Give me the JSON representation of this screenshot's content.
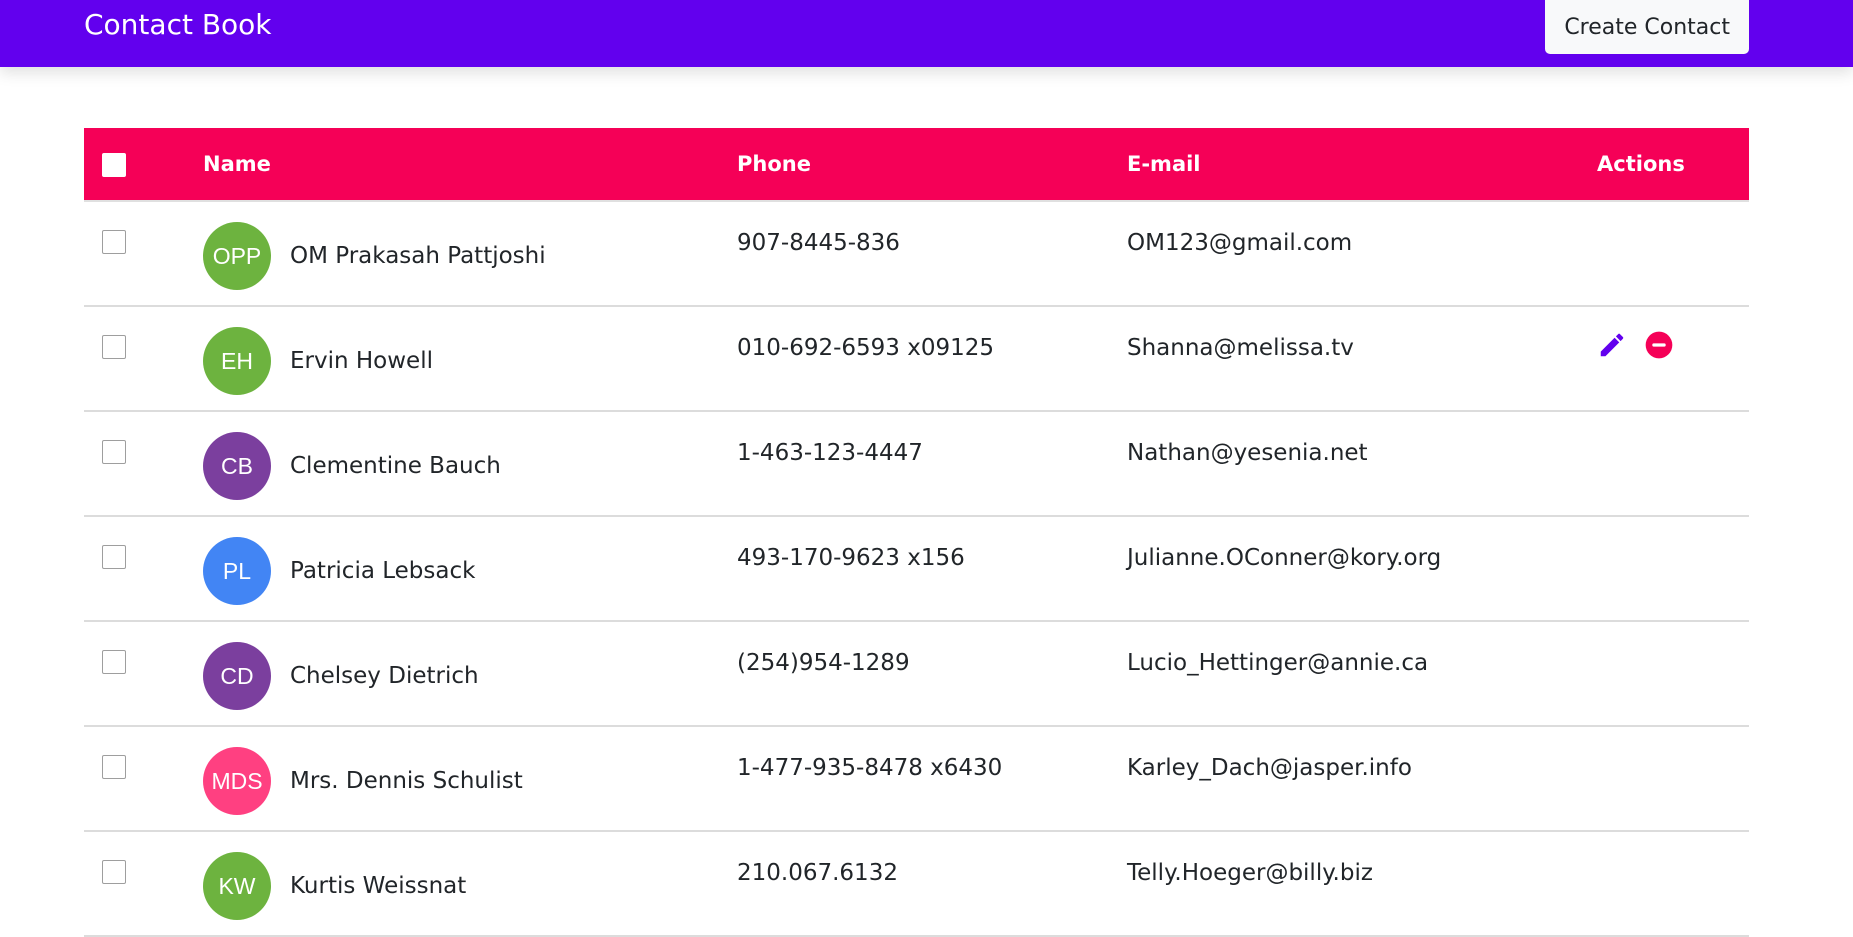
{
  "header": {
    "title": "Contact Book",
    "create_label": "Create Contact",
    "bg_color": "#6200ee"
  },
  "table": {
    "header_color": "#f50057",
    "columns": [
      "Name",
      "Phone",
      "E-mail",
      "Actions"
    ],
    "rows": [
      {
        "initials": "OPP",
        "name": "OM Prakasah Pattjoshi",
        "phone": "907-8445-836",
        "email": "OM123@gmail.com",
        "avatar_color": "#6db33f",
        "show_actions": false
      },
      {
        "initials": "EH",
        "name": "Ervin Howell",
        "phone": "010-692-6593 x09125",
        "email": "Shanna@melissa.tv",
        "avatar_color": "#6db33f",
        "show_actions": true
      },
      {
        "initials": "CB",
        "name": "Clementine Bauch",
        "phone": "1-463-123-4447",
        "email": "Nathan@yesenia.net",
        "avatar_color": "#7b3f9e",
        "show_actions": false
      },
      {
        "initials": "PL",
        "name": "Patricia Lebsack",
        "phone": "493-170-9623 x156",
        "email": "Julianne.OConner@kory.org",
        "avatar_color": "#4285f4",
        "show_actions": false
      },
      {
        "initials": "CD",
        "name": "Chelsey Dietrich",
        "phone": "(254)954-1289",
        "email": "Lucio_Hettinger@annie.ca",
        "avatar_color": "#7b3f9e",
        "show_actions": false
      },
      {
        "initials": "MDS",
        "name": "Mrs. Dennis Schulist",
        "phone": "1-477-935-8478 x6430",
        "email": "Karley_Dach@jasper.info",
        "avatar_color": "#ff4081",
        "show_actions": false
      },
      {
        "initials": "KW",
        "name": "Kurtis Weissnat",
        "phone": "210.067.6132",
        "email": "Telly.Hoeger@billy.biz",
        "avatar_color": "#6db33f",
        "show_actions": false
      }
    ],
    "actions": {
      "edit_icon": "pencil-icon",
      "edit_color": "#6200ee",
      "delete_icon": "minus-circle-icon",
      "delete_color": "#f50057"
    }
  }
}
